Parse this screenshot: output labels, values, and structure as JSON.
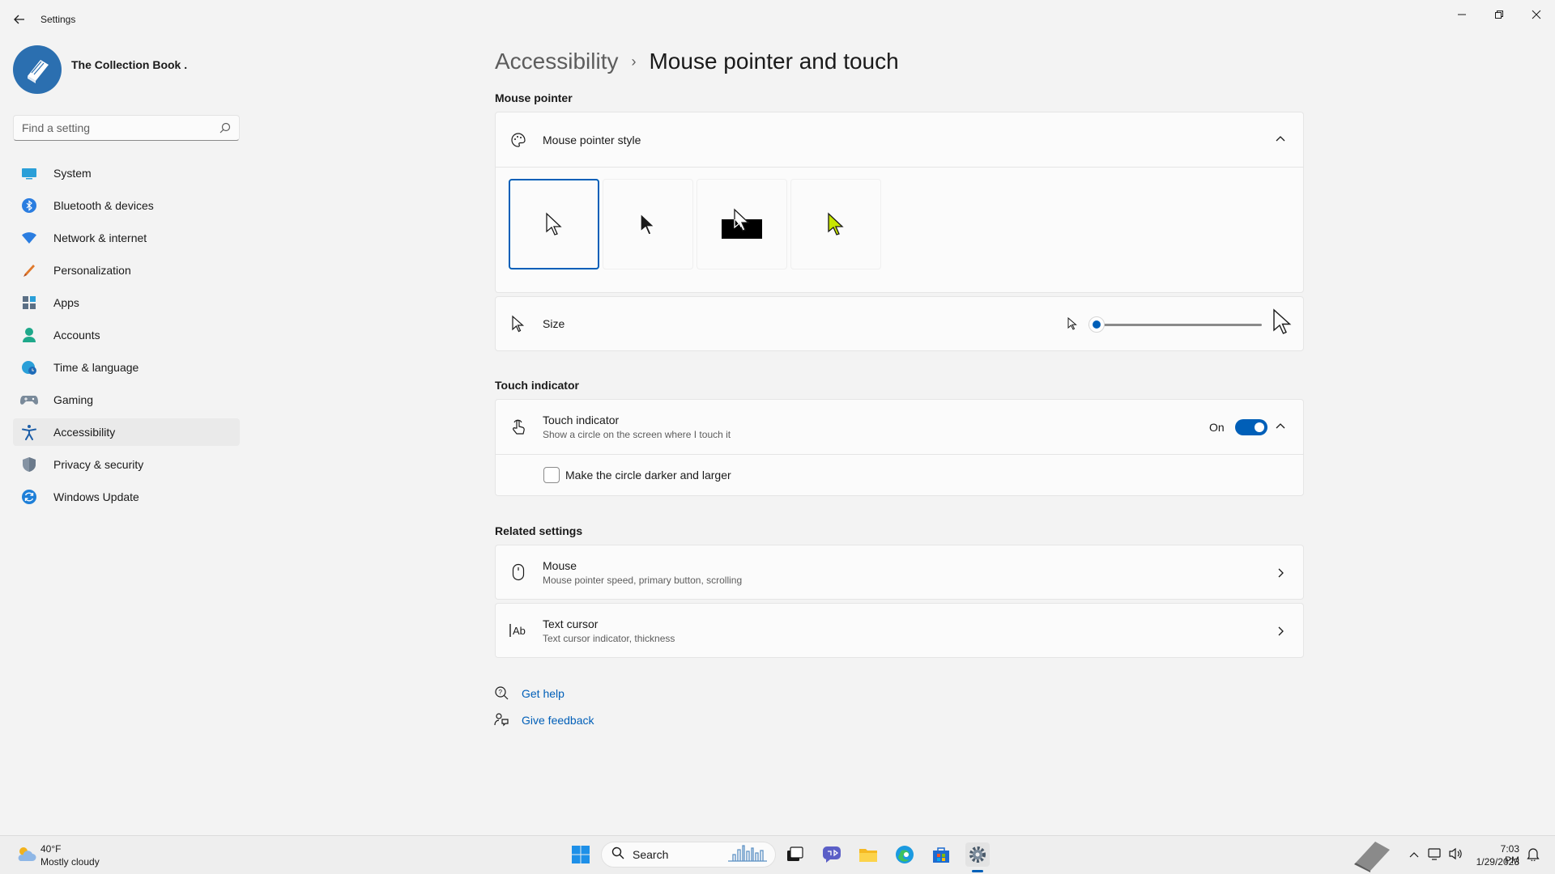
{
  "app": {
    "title": "Settings"
  },
  "profile": {
    "name": "The Collection Book ."
  },
  "search": {
    "placeholder": "Find a setting"
  },
  "sidebar": {
    "items": [
      {
        "label": "System",
        "icon": "monitor-icon"
      },
      {
        "label": "Bluetooth & devices",
        "icon": "bluetooth-icon"
      },
      {
        "label": "Network & internet",
        "icon": "wifi-icon"
      },
      {
        "label": "Personalization",
        "icon": "brush-icon"
      },
      {
        "label": "Apps",
        "icon": "apps-icon"
      },
      {
        "label": "Accounts",
        "icon": "person-icon"
      },
      {
        "label": "Time & language",
        "icon": "globe-clock-icon"
      },
      {
        "label": "Gaming",
        "icon": "gamepad-icon"
      },
      {
        "label": "Accessibility",
        "icon": "accessibility-icon",
        "active": true
      },
      {
        "label": "Privacy & security",
        "icon": "shield-icon"
      },
      {
        "label": "Windows Update",
        "icon": "update-icon"
      }
    ]
  },
  "breadcrumb": {
    "parent": "Accessibility",
    "separator": "›",
    "current": "Mouse pointer and touch"
  },
  "mouse_pointer": {
    "heading": "Mouse pointer",
    "style_label": "Mouse pointer style",
    "styles": [
      "white",
      "black",
      "inverted",
      "custom"
    ],
    "selected_style": "white",
    "custom_color": "#c8e600",
    "size_label": "Size",
    "size_value": 0
  },
  "touch_indicator": {
    "heading": "Touch indicator",
    "title": "Touch indicator",
    "subtitle": "Show a circle on the screen where I touch it",
    "state": "On",
    "checkbox_label": "Make the circle darker and larger",
    "checkbox_checked": false
  },
  "related": {
    "heading": "Related settings",
    "items": [
      {
        "title": "Mouse",
        "subtitle": "Mouse pointer speed, primary button, scrolling",
        "icon": "mouse-icon"
      },
      {
        "title": "Text cursor",
        "subtitle": "Text cursor indicator, thickness",
        "icon": "text-cursor-icon"
      }
    ]
  },
  "help": {
    "get_help": "Get help",
    "give_feedback": "Give feedback"
  },
  "taskbar": {
    "weather_temp": "40°F",
    "weather_desc": "Mostly cloudy",
    "search_label": "Search",
    "time": "7:03 PM",
    "date": "1/29/2023"
  },
  "colors": {
    "accent": "#005fb8",
    "background": "#f3f3f3",
    "card": "#fbfbfb"
  }
}
